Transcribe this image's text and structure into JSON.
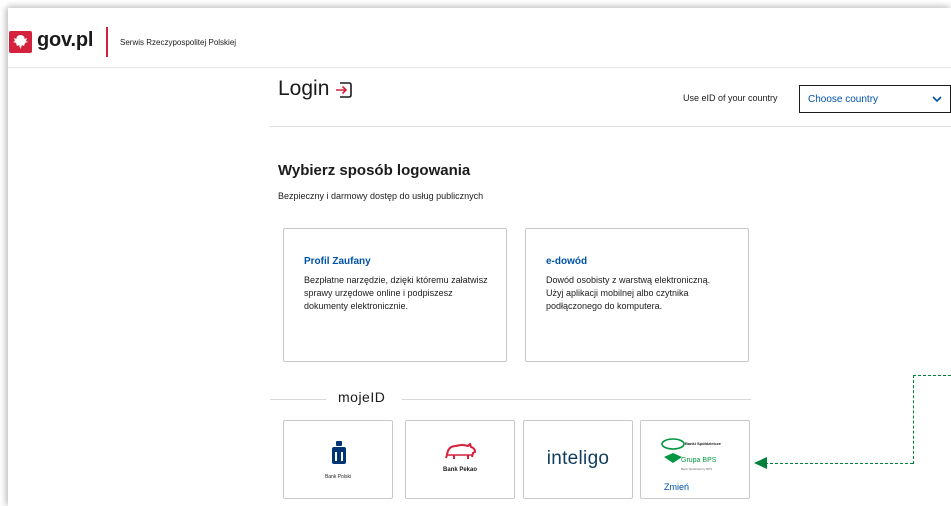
{
  "header": {
    "logo_text": "gov.pl",
    "service_name": "Serwis Rzeczypospolitej Polskiej"
  },
  "login": {
    "title": "Login",
    "eid_label": "Use eID of your country",
    "country_select": "Choose country"
  },
  "methods": {
    "title": "Wybierz sposób logowania",
    "subtitle": "Bezpieczny i darmowy dostęp do usług publicznych",
    "cards": [
      {
        "title": "Profil Zaufany",
        "description": "Bezpłatne narzędzie, dzięki któremu załatwisz sprawy urzędowe online i podpiszesz dokumenty elektronicznie."
      },
      {
        "title": "e-dowód",
        "description": "Dowód osobisty z warstwą elektroniczną. Użyj aplikacji mobilnej albo czytnika podłączonego do komputera."
      }
    ]
  },
  "mojeid": {
    "label": "mojeID"
  },
  "banks": [
    {
      "label": "Bank Polski"
    },
    {
      "label": "Bank Pekao"
    },
    {
      "label": "inteligo"
    },
    {
      "top_label": "Banki Spółdzielcze",
      "name": "Grupa BPS",
      "small": "Bank Spółdzielczy BPS",
      "change_link": "Zmień"
    }
  ],
  "colors": {
    "brand_red": "#d4213d",
    "link_blue": "#0052a5",
    "annotation_green": "#00803a"
  }
}
